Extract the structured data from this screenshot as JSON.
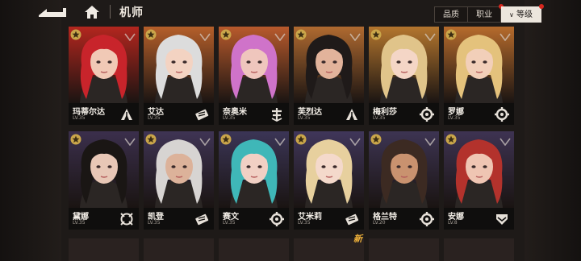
{
  "header": {
    "title": "机师",
    "sort_buttons": [
      {
        "label": "品质",
        "active": false,
        "dot": false
      },
      {
        "label": "职业",
        "active": false,
        "dot": true
      },
      {
        "label": "等级",
        "active": true,
        "dot": true
      }
    ]
  },
  "colors": {
    "accent_dot": "#d8271e",
    "new_tag": "#f0b23a"
  },
  "cards": [
    {
      "name": "玛蒂尔达",
      "level": "LV.35",
      "class_icon": "sniper-icon",
      "bg": "#b3261e",
      "hair": "#c8242b",
      "skin": "#f1c9b6"
    },
    {
      "name": "艾达",
      "level": "LV.35",
      "class_icon": "assault-icon",
      "bg": "#b55f2a",
      "hair": "#dcdcdc",
      "skin": "#f3d3c2"
    },
    {
      "name": "奈奥米",
      "level": "LV.35",
      "class_icon": "support-icon",
      "bg": "#b85a2c",
      "hair": "#cf73c9",
      "skin": "#efc6bd"
    },
    {
      "name": "芙烈达",
      "level": "LV.35",
      "class_icon": "sniper-icon",
      "bg": "#b06a30",
      "hair": "#1f1a19",
      "skin": "#e2b39b"
    },
    {
      "name": "梅利莎",
      "level": "LV.35",
      "class_icon": "engineer-icon",
      "bg": "#b4762e",
      "hair": "#e0c48a",
      "skin": "#f4d6c6"
    },
    {
      "name": "罗娜",
      "level": "LV.35",
      "class_icon": "engineer-icon",
      "bg": "#b66b2c",
      "hair": "#e4c27c",
      "skin": "#f2cfb9"
    },
    {
      "name": "黛娜",
      "level": "LV.35",
      "class_icon": "target-icon",
      "bg": "#3b2f4c",
      "hair": "#1a1614",
      "skin": "#e8c7b6"
    },
    {
      "name": "凯登",
      "level": "LV.35",
      "class_icon": "assault-icon",
      "bg": "#3f3454",
      "hair": "#d7d4d2",
      "skin": "#dcb29a"
    },
    {
      "name": "赛文",
      "level": "LV.35",
      "class_icon": "engineer-icon",
      "bg": "#3b3556",
      "hair": "#3fb7b8",
      "skin": "#f1d0c4"
    },
    {
      "name": "艾米莉",
      "level": "LV.35",
      "class_icon": "assault-icon",
      "bg": "#40365a",
      "hair": "#e7d09e",
      "skin": "#f4d9cb"
    },
    {
      "name": "格兰特",
      "level": "LV.20",
      "class_icon": "engineer-icon",
      "bg": "#3d3452",
      "hair": "#3c2a22",
      "skin": "#c9926f"
    },
    {
      "name": "安娜",
      "level": "LV.8",
      "class_icon": "tank-icon",
      "bg": "#3e3352",
      "hair": "#b3322c",
      "skin": "#efc5b3"
    }
  ],
  "new_label": "新"
}
